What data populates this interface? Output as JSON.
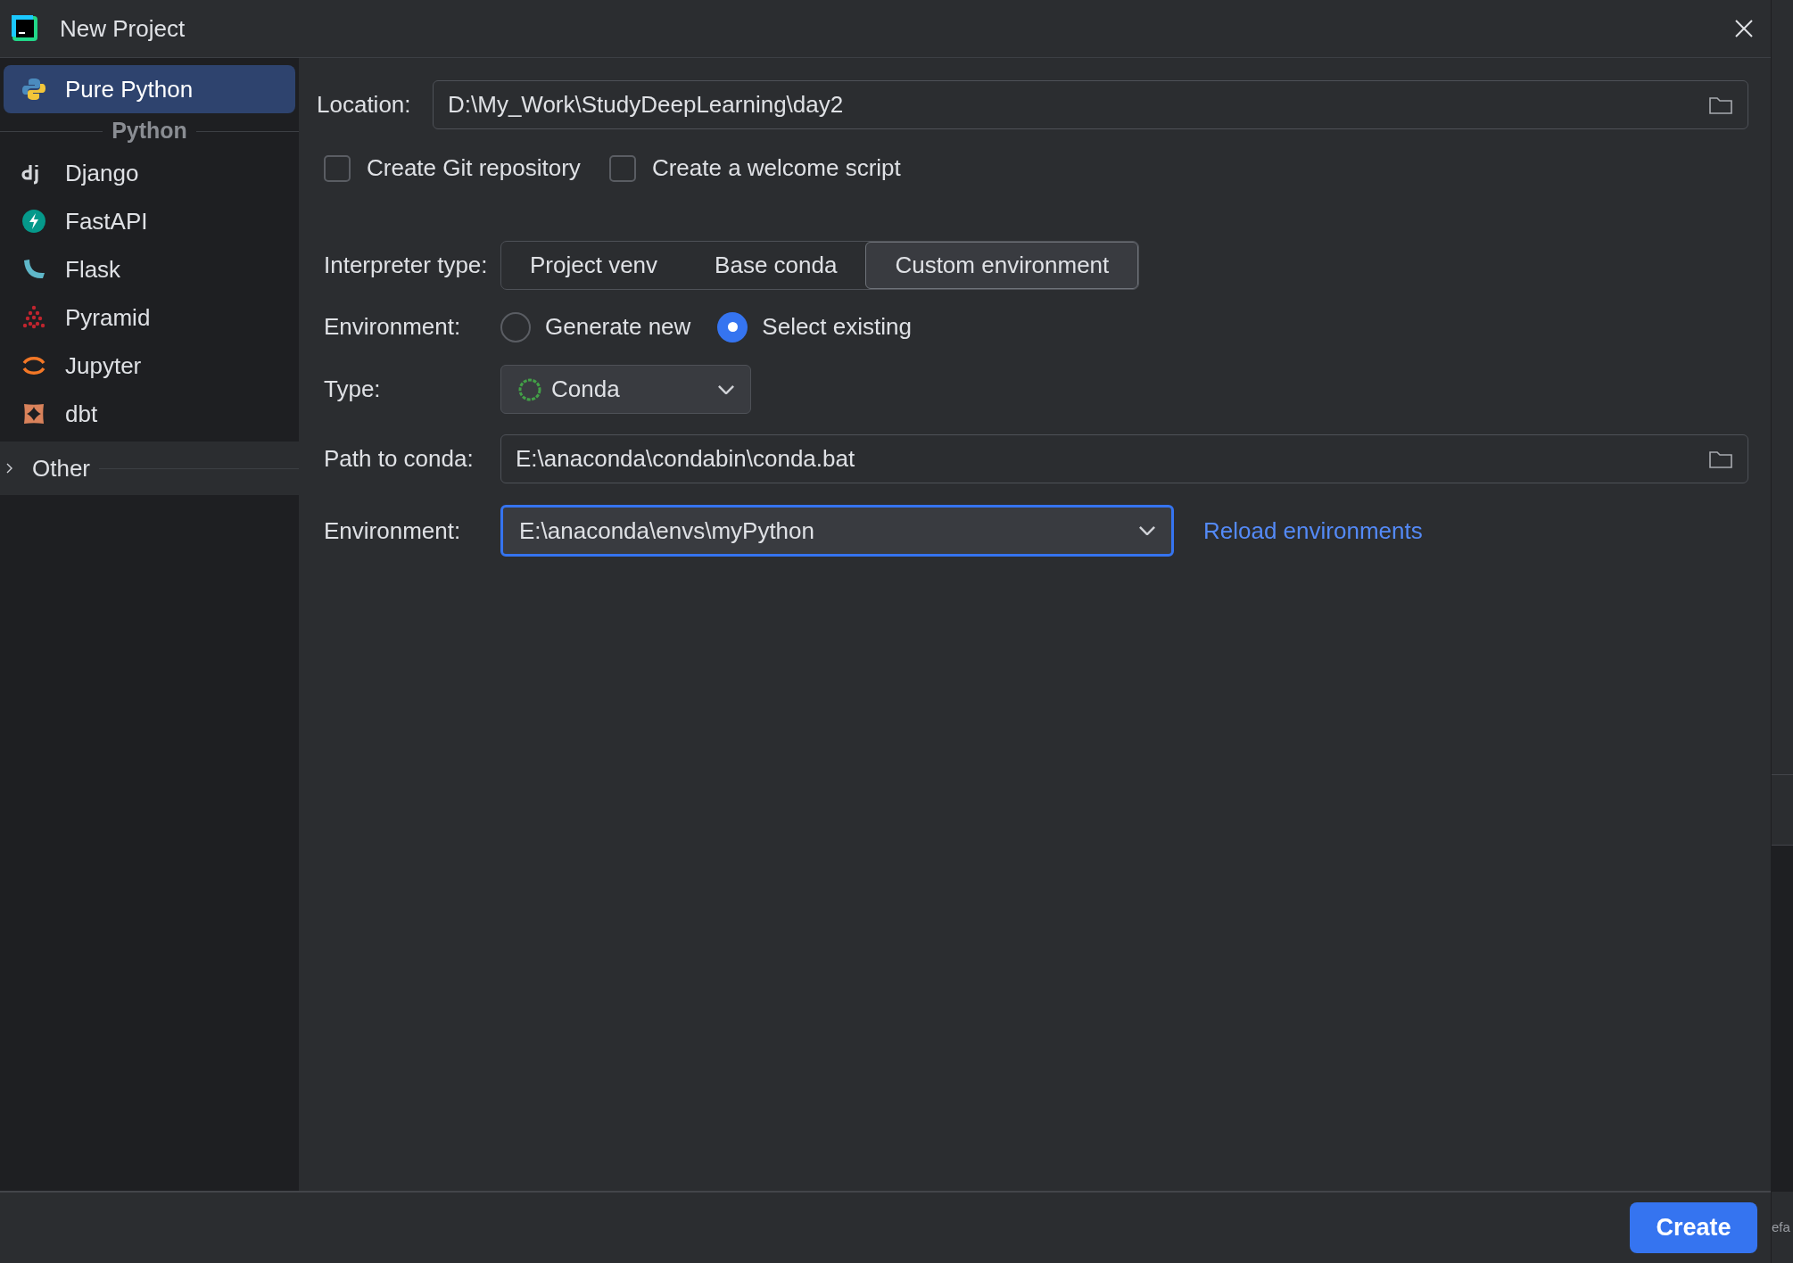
{
  "window": {
    "title": "New Project"
  },
  "sidebar": {
    "items": [
      {
        "label": "Pure Python",
        "selected": true
      }
    ],
    "group_header": "Python",
    "group_items": [
      {
        "label": "Django",
        "selected": false
      },
      {
        "label": "FastAPI",
        "selected": false
      },
      {
        "label": "Flask",
        "selected": false
      },
      {
        "label": "Pyramid",
        "selected": false
      },
      {
        "label": "Jupyter",
        "selected": false
      },
      {
        "label": "dbt",
        "selected": false
      }
    ],
    "other": {
      "label": "Other",
      "expanded": false
    }
  },
  "form": {
    "location": {
      "label": "Location:",
      "value": "D:\\My_Work\\StudyDeepLearning\\day2"
    },
    "checkboxes": [
      {
        "label": "Create Git repository",
        "checked": false
      },
      {
        "label": "Create a welcome script",
        "checked": false
      }
    ],
    "interpreter_type": {
      "label": "Interpreter type:",
      "options": [
        {
          "label": "Project venv",
          "selected": false
        },
        {
          "label": "Base conda",
          "selected": false
        },
        {
          "label": "Custom environment",
          "selected": true
        }
      ]
    },
    "environment_mode": {
      "label": "Environment:",
      "options": [
        {
          "label": "Generate new",
          "selected": false
        },
        {
          "label": "Select existing",
          "selected": true
        }
      ]
    },
    "type": {
      "label": "Type:",
      "value": "Conda"
    },
    "path_to_conda": {
      "label": "Path to conda:",
      "value": "E:\\anaconda\\condabin\\conda.bat"
    },
    "environment": {
      "label": "Environment:",
      "value": "E:\\anaconda\\envs\\myPython",
      "focused": true
    },
    "reload_link": "Reload environments"
  },
  "footer": {
    "button": "Create"
  },
  "background_window": {
    "text": "efa"
  }
}
